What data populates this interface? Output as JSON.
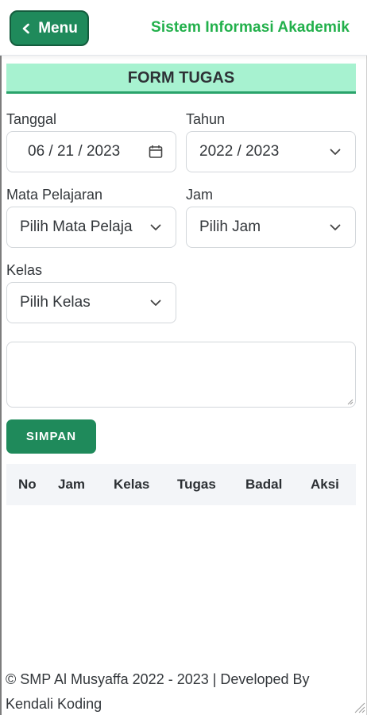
{
  "header": {
    "menu_label": "Menu",
    "menu_icon": "chevron-left-icon",
    "brand": "Sistem Informasi Akademik"
  },
  "form": {
    "title": "FORM TUGAS",
    "tanggal_label": "Tanggal",
    "tanggal_value": "06 / 21 / 2023",
    "tahun_label": "Tahun",
    "tahun_value": "2022 / 2023",
    "mapel_label": "Mata Pelajaran",
    "mapel_value": "Pilih Mata Pelaja",
    "jam_label": "Jam",
    "jam_value": "Pilih Jam",
    "kelas_label": "Kelas",
    "kelas_value": "Pilih Kelas",
    "submit_label": "SIMPAN"
  },
  "table": {
    "columns": [
      "No",
      "Jam",
      "Kelas",
      "Tugas",
      "Badal",
      "Aksi"
    ]
  },
  "footer": {
    "text": "© SMP Al Musyaffa 2022 - 2023 | Developed By Kendali Koding"
  },
  "colors": {
    "primary": "#1f8a5b",
    "brand_text": "#22b04b",
    "title_bg": "#a7f2d0"
  }
}
